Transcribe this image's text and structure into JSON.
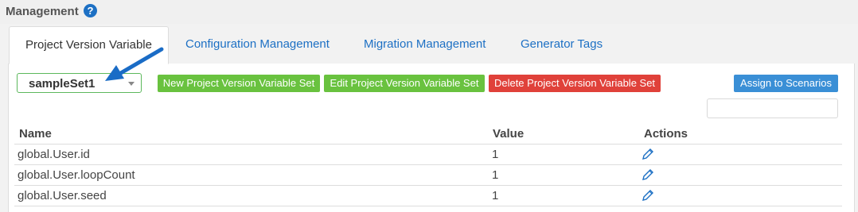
{
  "header": {
    "title": "Management",
    "help_icon": "question-circle-icon"
  },
  "tabs": [
    {
      "label": "Project Version Variable",
      "active": true
    },
    {
      "label": "Configuration Management",
      "active": false
    },
    {
      "label": "Migration Management",
      "active": false
    },
    {
      "label": "Generator Tags",
      "active": false
    }
  ],
  "toolbar": {
    "set_select_value": "sampleSet1",
    "new_label": "New Project Version Variable Set",
    "edit_label": "Edit Project Version Variable Set",
    "delete_label": "Delete Project Version Variable Set",
    "assign_label": "Assign to Scenarios",
    "search_value": ""
  },
  "table": {
    "columns": [
      "Name",
      "Value",
      "Actions"
    ],
    "rows": [
      {
        "name": "global.User.id",
        "value": "1",
        "action_icon": "pencil-icon"
      },
      {
        "name": "global.User.loopCount",
        "value": "1",
        "action_icon": "pencil-icon"
      },
      {
        "name": "global.User.seed",
        "value": "1",
        "action_icon": "pencil-icon"
      }
    ]
  },
  "colors": {
    "link": "#1d70c4",
    "green": "#69c23f",
    "red": "#e0413a",
    "blue": "#3a8fd6",
    "annotation_arrow": "#1a6cc6"
  }
}
